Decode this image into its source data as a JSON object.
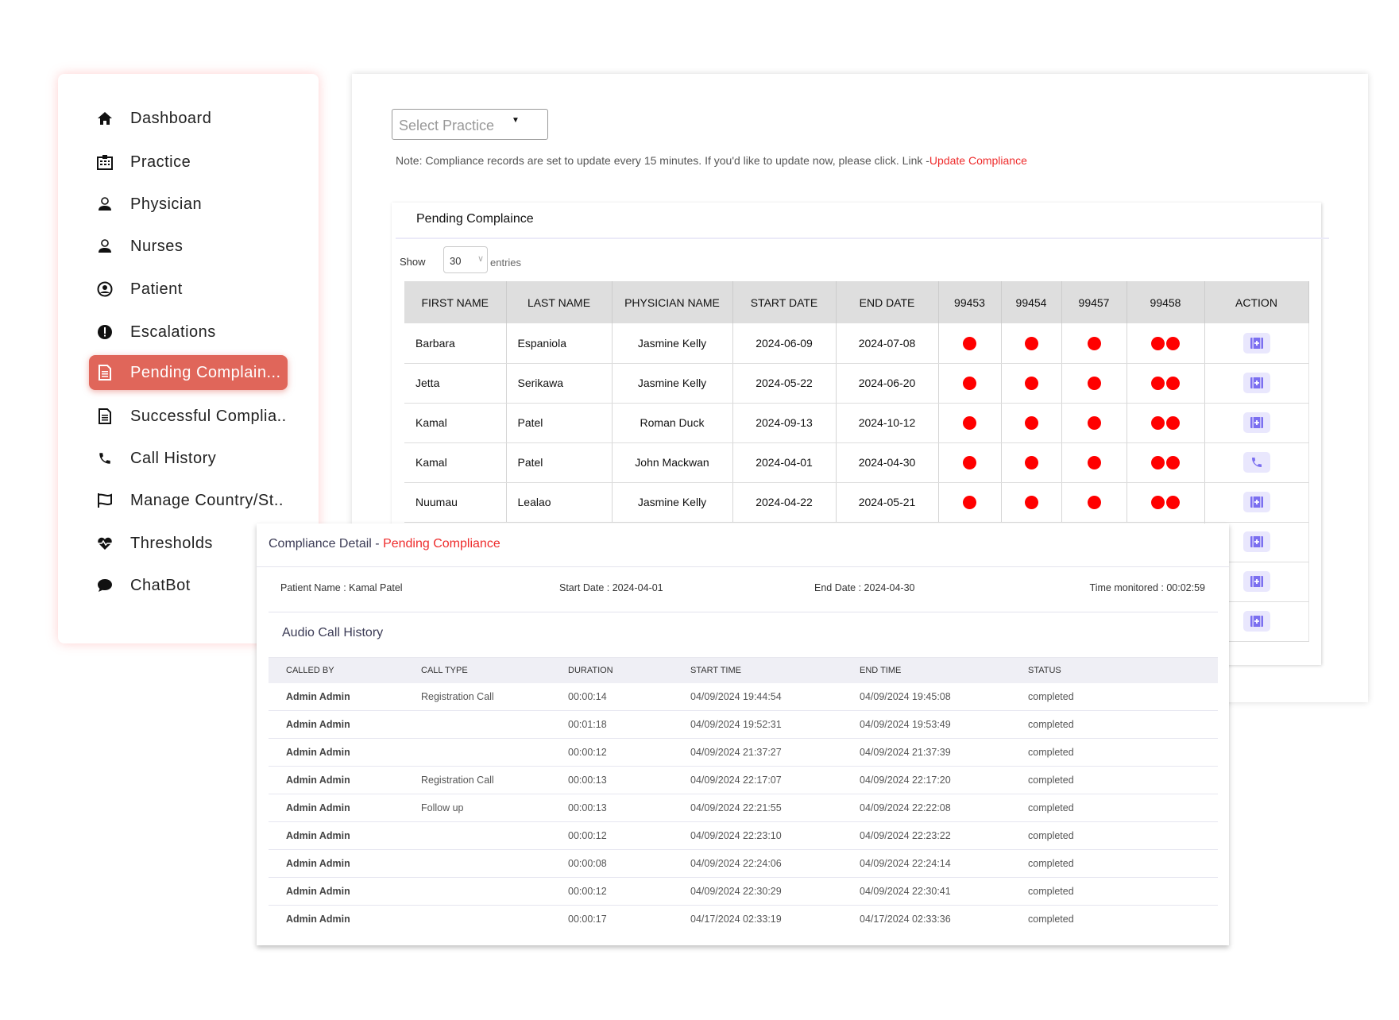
{
  "sidebar": {
    "items": [
      {
        "label": "Dashboard",
        "icon": "home-icon"
      },
      {
        "label": "Practice",
        "icon": "hospital-icon"
      },
      {
        "label": "Physician",
        "icon": "doctor-icon"
      },
      {
        "label": "Nurses",
        "icon": "nurse-icon"
      },
      {
        "label": "Patient",
        "icon": "user-circle-icon"
      },
      {
        "label": "Escalations",
        "icon": "alert-icon"
      },
      {
        "label": "Pending Complain...",
        "icon": "document-icon",
        "active": true
      },
      {
        "label": "Successful Complia..",
        "icon": "document-icon"
      },
      {
        "label": "Call History",
        "icon": "phone-icon"
      },
      {
        "label": "Manage Country/St..",
        "icon": "flag-icon"
      },
      {
        "label": "Thresholds",
        "icon": "heartbeat-icon"
      },
      {
        "label": "ChatBot",
        "icon": "chat-icon"
      }
    ]
  },
  "main": {
    "select_practice": "Select Practice",
    "note": "Note: Compliance records are set to update every 15 minutes. If you'd like to update now, please click. Link -",
    "note_link": "Update Compliance",
    "pending": {
      "title": "Pending Complaince",
      "show_label": "Show",
      "entries_value": "30",
      "entries_label": "entries",
      "columns": [
        "FIRST NAME",
        "LAST NAME",
        "PHYSICIAN NAME",
        "START DATE",
        "END DATE",
        "99453",
        "99454",
        "99457",
        "99458",
        "ACTION"
      ],
      "rows": [
        {
          "first": "Barbara",
          "last": "Espaniola",
          "physician": "Jasmine Kelly",
          "start": "2024-06-09",
          "end": "2024-07-08",
          "action": "kit"
        },
        {
          "first": "Jetta",
          "last": "Serikawa",
          "physician": "Jasmine Kelly",
          "start": "2024-05-22",
          "end": "2024-06-20",
          "action": "kit"
        },
        {
          "first": "Kamal",
          "last": "Patel",
          "physician": "Roman Duck",
          "start": "2024-09-13",
          "end": "2024-10-12",
          "action": "kit"
        },
        {
          "first": "Kamal",
          "last": "Patel",
          "physician": "John Mackwan",
          "start": "2024-04-01",
          "end": "2024-04-30",
          "action": "phone"
        },
        {
          "first": "Nuumau",
          "last": "Lealao",
          "physician": "Jasmine Kelly",
          "start": "2024-04-22",
          "end": "2024-05-21",
          "action": "kit"
        },
        {
          "first": "",
          "last": "",
          "physician": "",
          "start": "",
          "end": "",
          "action": "kit"
        },
        {
          "first": "",
          "last": "",
          "physician": "",
          "start": "",
          "end": "",
          "action": "kit"
        },
        {
          "first": "",
          "last": "",
          "physician": "",
          "start": "",
          "end": "",
          "action": "kit"
        }
      ],
      "status_color": "#ff0000",
      "action_color": "#7b6ff0"
    }
  },
  "detail": {
    "title": "Compliance Detail - ",
    "title_status": "Pending Compliance",
    "patient_name": "Patient Name : Kamal Patel",
    "start_date": "Start Date : 2024-04-01",
    "end_date": "End Date : 2024-04-30",
    "time_monitored": "Time monitored : 00:02:59",
    "audio_title": "Audio Call History",
    "columns": [
      "CALLED BY",
      "CALL TYPE",
      "DURATION",
      "START TIME",
      "END TIME",
      "STATUS"
    ],
    "rows": [
      [
        "Admin Admin",
        "Registration Call",
        "00:00:14",
        "04/09/2024 19:44:54",
        "04/09/2024 19:45:08",
        "completed"
      ],
      [
        "Admin Admin",
        "",
        "00:01:18",
        "04/09/2024 19:52:31",
        "04/09/2024 19:53:49",
        "completed"
      ],
      [
        "Admin Admin",
        "",
        "00:00:12",
        "04/09/2024 21:37:27",
        "04/09/2024 21:37:39",
        "completed"
      ],
      [
        "Admin Admin",
        "Registration Call",
        "00:00:13",
        "04/09/2024 22:17:07",
        "04/09/2024 22:17:20",
        "completed"
      ],
      [
        "Admin Admin",
        "Follow up",
        "00:00:13",
        "04/09/2024 22:21:55",
        "04/09/2024 22:22:08",
        "completed"
      ],
      [
        "Admin Admin",
        "",
        "00:00:12",
        "04/09/2024 22:23:10",
        "04/09/2024 22:23:22",
        "completed"
      ],
      [
        "Admin Admin",
        "",
        "00:00:08",
        "04/09/2024 22:24:06",
        "04/09/2024 22:24:14",
        "completed"
      ],
      [
        "Admin Admin",
        "",
        "00:00:12",
        "04/09/2024 22:30:29",
        "04/09/2024 22:30:41",
        "completed"
      ],
      [
        "Admin Admin",
        "",
        "00:00:17",
        "04/17/2024 02:33:19",
        "04/17/2024 02:33:36",
        "completed"
      ]
    ]
  }
}
